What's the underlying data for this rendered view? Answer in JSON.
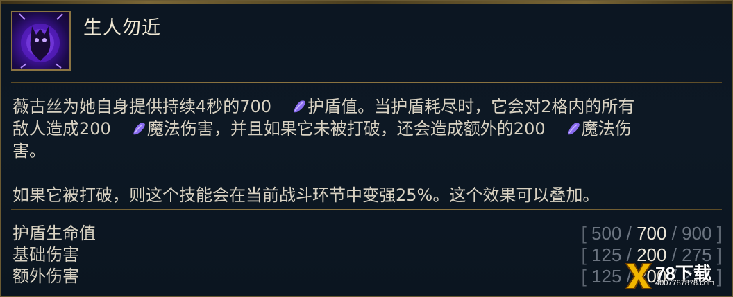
{
  "ability": {
    "name": "生人勿近",
    "icon": "shadow-shield-icon"
  },
  "description": {
    "line1_a": "薇古丝为她自身提供持续4秒的700",
    "line1_b": "护盾值。当护盾耗尽时，它会对2格内的所有",
    "line2_a": "敌人造成200",
    "line2_b": "魔法伤害，并且如果它未被打破，还会造成额外的200",
    "line2_c": "魔法伤",
    "line3": "害。",
    "line5": "如果它被打破，则这个技能会在当前战斗环节中变强25%。这个效果可以叠加。"
  },
  "stats": [
    {
      "label": "护盾生命值",
      "values": [
        "500",
        "700",
        "900"
      ],
      "active_index": 1
    },
    {
      "label": "基础伤害",
      "values": [
        "125",
        "200",
        "275"
      ],
      "active_index": 1
    },
    {
      "label": "额外伤害",
      "values": [
        "125",
        "200",
        "275"
      ],
      "active_index": 1
    }
  ],
  "watermark": {
    "brand": "78下载",
    "url": "4007787878.com"
  },
  "colors": {
    "border_gold": "#6a5a33",
    "text": "#d9d2c2",
    "dimmed_value": "#6b7480",
    "active_value": "#ece6d8",
    "magic_icon": "#8a6cf0"
  }
}
